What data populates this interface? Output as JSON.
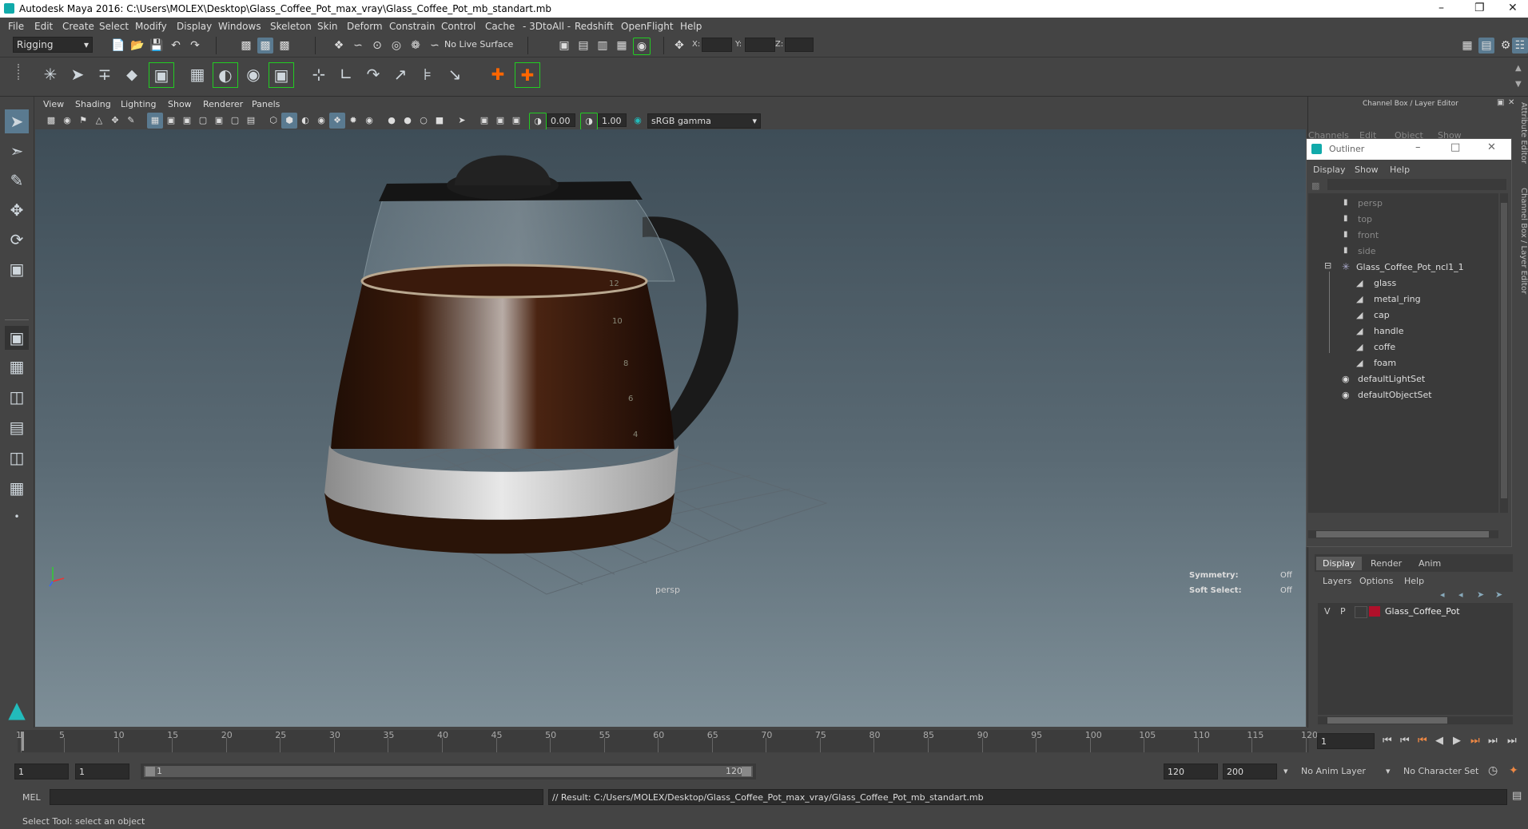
{
  "window": {
    "title": "Autodesk Maya 2016: C:\\Users\\MOLEX\\Desktop\\Glass_Coffee_Pot_max_vray\\Glass_Coffee_Pot_mb_standart.mb"
  },
  "menubar": [
    "File",
    "Edit",
    "Create",
    "Select",
    "Modify",
    "Display",
    "Windows",
    "Skeleton",
    "Skin",
    "Deform",
    "Constrain",
    "Control",
    "Cache",
    "- 3DtoAll -",
    "Redshift",
    "OpenFlight",
    "Help"
  ],
  "statusline": {
    "mode": "Rigging",
    "live_surface": "No Live Surface",
    "x_label": "X:",
    "y_label": "Y:",
    "z_label": "Z:"
  },
  "panel": {
    "menus": [
      "View",
      "Shading",
      "Lighting",
      "Show",
      "Renderer",
      "Panels"
    ],
    "exposure": "0.00",
    "gamma": "1.00",
    "color_space": "sRGB gamma",
    "camera_label": "persp",
    "symmetry_label": "Symmetry:",
    "symmetry_value": "Off",
    "soft_select_label": "Soft Select:",
    "soft_select_value": "Off"
  },
  "channel_box": {
    "title": "Channel Box / Layer Editor",
    "menus": [
      "Channels",
      "Edit",
      "Object",
      "Show"
    ]
  },
  "side_tabs": [
    "Attribute Editor",
    "Channel Box / Layer Editor"
  ],
  "outliner": {
    "title": "Outliner",
    "menus": [
      "Display",
      "Show",
      "Help"
    ],
    "cameras": [
      "persp",
      "top",
      "front",
      "side"
    ],
    "group": "Glass_Coffee_Pot_ncl1_1",
    "children": [
      "glass",
      "metal_ring",
      "cap",
      "handle",
      "coffe",
      "foam"
    ],
    "sets": [
      "defaultLightSet",
      "defaultObjectSet"
    ]
  },
  "layer_editor": {
    "tabs": [
      "Display",
      "Render",
      "Anim"
    ],
    "menus": [
      "Layers",
      "Options",
      "Help"
    ],
    "layer_v": "V",
    "layer_p": "P",
    "layer_name": "Glass_Coffee_Pot",
    "layer_color": "#b0102a"
  },
  "timeline": {
    "ticks": [
      "1",
      "5",
      "10",
      "15",
      "20",
      "25",
      "30",
      "35",
      "40",
      "45",
      "50",
      "55",
      "60",
      "65",
      "70",
      "75",
      "80",
      "85",
      "90",
      "95",
      "100",
      "105",
      "110",
      "115",
      "120"
    ],
    "current_frame": "1"
  },
  "range": {
    "start": "1",
    "anim_start": "1",
    "range_start_label": "1",
    "range_end_label": "120",
    "range_end": "120",
    "anim_end": "200",
    "anim_layer": "No Anim Layer",
    "character_set": "No Character Set"
  },
  "command": {
    "label": "MEL",
    "result": "// Result: C:/Users/MOLEX/Desktop/Glass_Coffee_Pot_max_vray/Glass_Coffee_Pot_mb_standart.mb"
  },
  "helpline": "Select Tool: select an object",
  "pot_scale": [
    "12",
    "10",
    "8",
    "6",
    "4"
  ]
}
